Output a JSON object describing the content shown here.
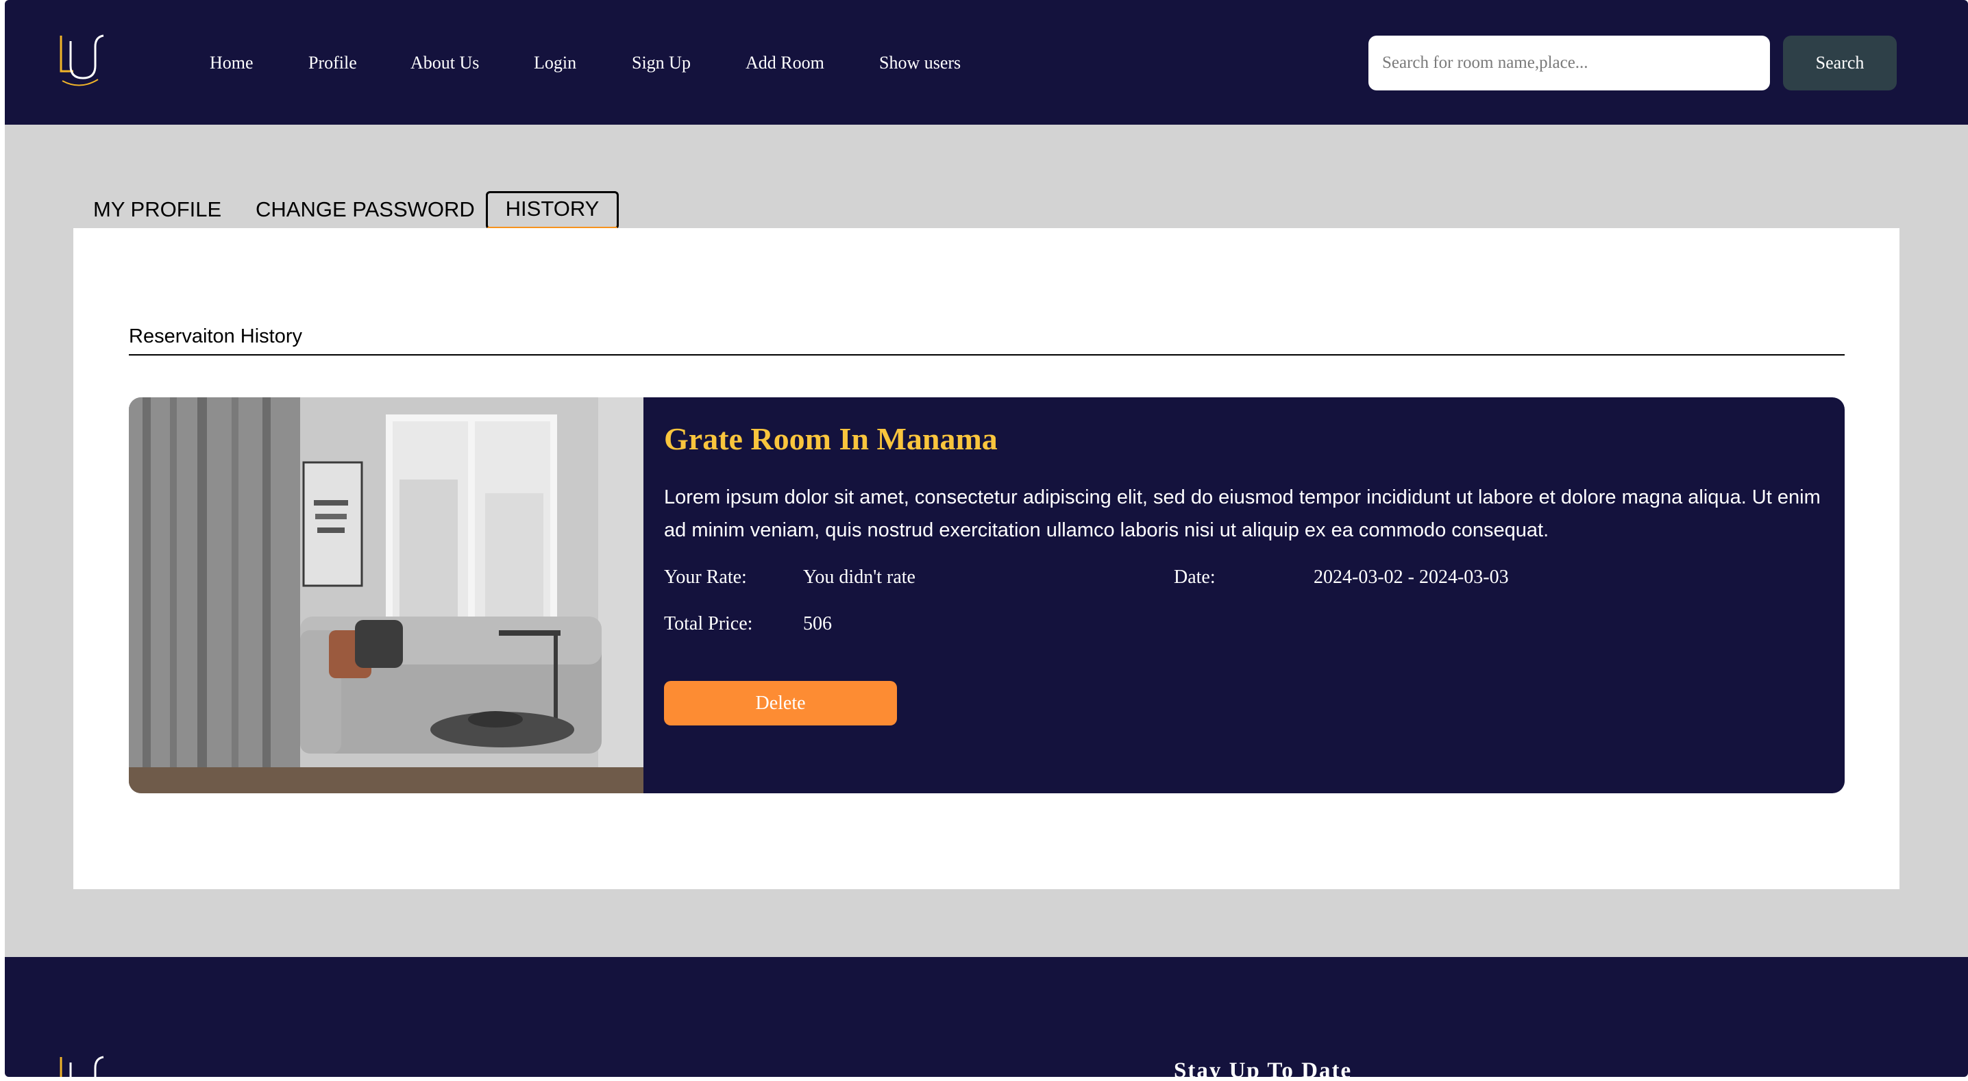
{
  "header": {
    "logo_icon": "lu-logo-icon",
    "nav": [
      {
        "label": "Home"
      },
      {
        "label": "Profile"
      },
      {
        "label": "About Us"
      },
      {
        "label": "Login"
      },
      {
        "label": "Sign Up"
      },
      {
        "label": "Add Room"
      },
      {
        "label": "Show users"
      }
    ],
    "search": {
      "placeholder": "Search for room name,place...",
      "value": "",
      "button_label": "Search"
    }
  },
  "tabs": [
    {
      "label": "MY PROFILE",
      "active": false
    },
    {
      "label": "CHANGE PASSWORD",
      "active": false
    },
    {
      "label": "HISTORY",
      "active": true
    }
  ],
  "history": {
    "title": "Reservaiton History",
    "reservations": [
      {
        "image_icon": "room-photo-image",
        "room_name": "Grate Room In Manama",
        "description": "Lorem ipsum dolor sit amet, consectetur adipiscing elit, sed do eiusmod tempor incididunt ut labore et dolore magna aliqua. Ut enim ad minim veniam, quis nostrud exercitation ullamco laboris nisi ut aliquip ex ea commodo consequat.",
        "rate_label": "Your Rate:",
        "rate_value": "You didn't rate",
        "date_label": "Date:",
        "date_value": "2024-03-02 - 2024-03-03",
        "price_label": "Total Price:",
        "price_value": "506",
        "delete_label": "Delete"
      }
    ]
  },
  "footer": {
    "logo_icon": "lu-logo-icon",
    "heading": "Stay Up To Date"
  },
  "colors": {
    "navy": "#14123d",
    "accent_yellow": "#f9c53d",
    "accent_orange": "#fd8c33",
    "search_button": "#2e4048",
    "page_bg": "#d3d3d3"
  }
}
